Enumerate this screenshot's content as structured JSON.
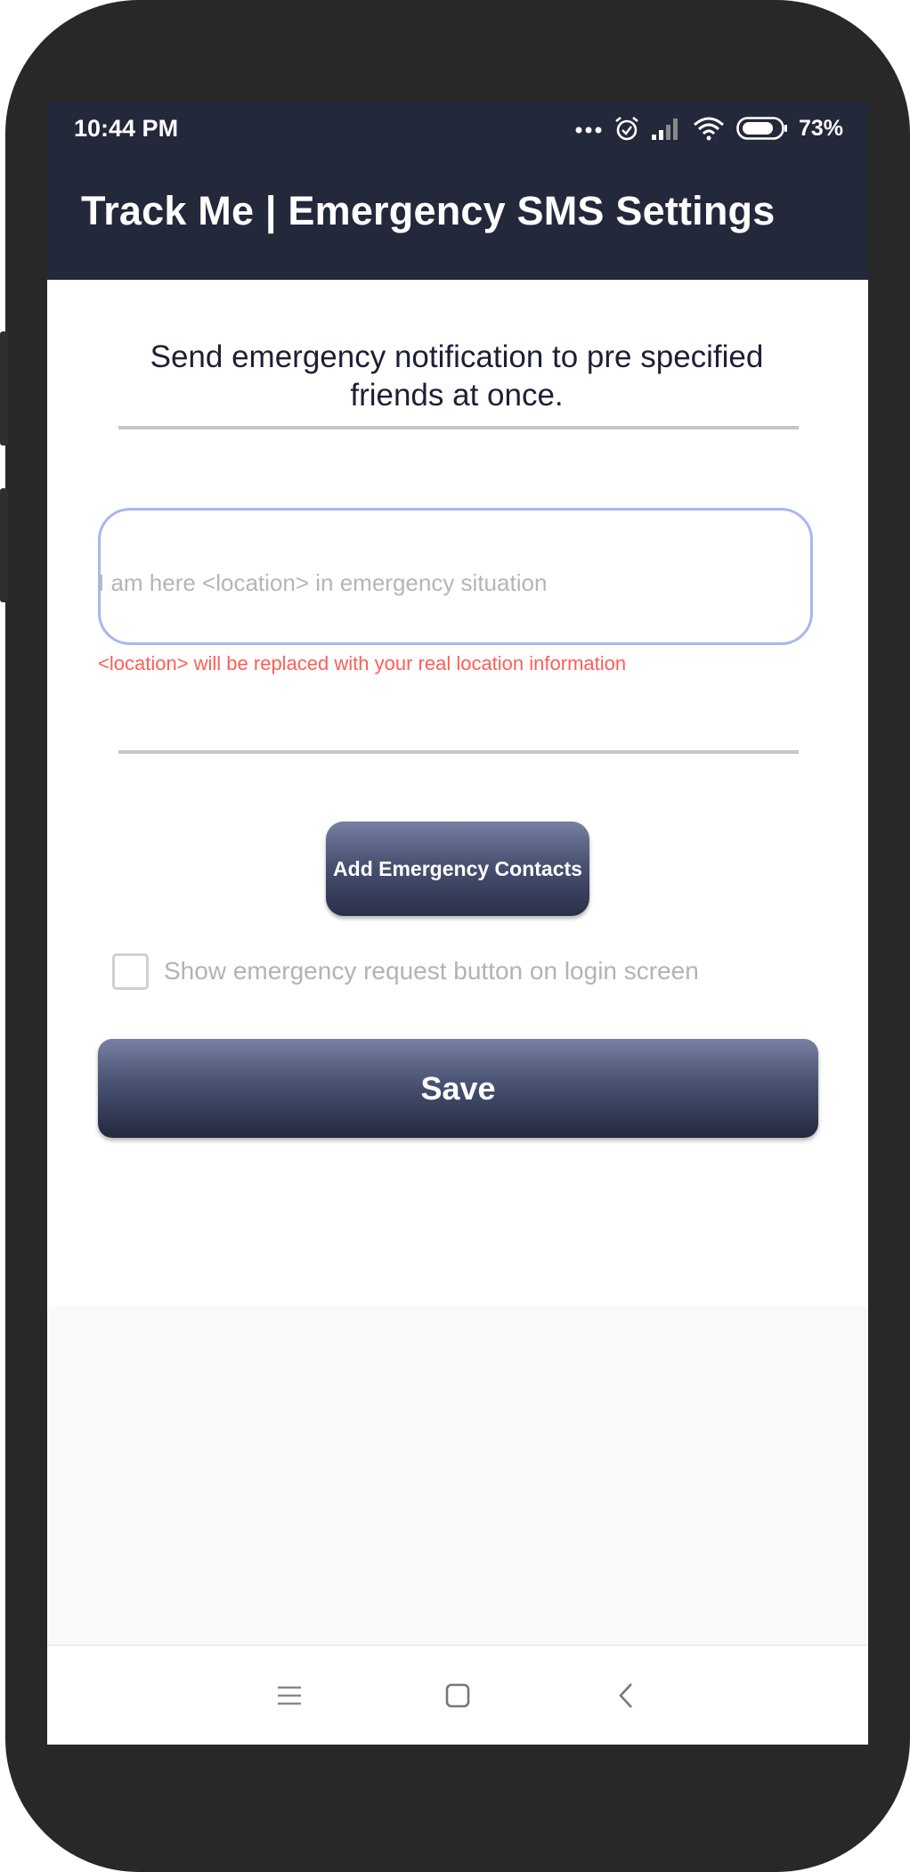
{
  "status_bar": {
    "time": "10:44 PM",
    "battery_percent": "73%",
    "icons": [
      "more-dots-icon",
      "alarm-icon",
      "signal-icon",
      "wifi-icon",
      "battery-icon"
    ]
  },
  "app_bar": {
    "title": "Track Me | Emergency SMS Settings"
  },
  "main": {
    "description": "Send emergency notification to pre specified friends at once.",
    "message_input": {
      "value": "",
      "placeholder": "I am here <location> in emergency situation"
    },
    "location_hint": "<location> will be replaced with your real location information",
    "add_contacts_label": "Add Emergency Contacts",
    "show_button_checkbox": {
      "label": "Show emergency request button on login screen",
      "checked": false
    },
    "save_label": "Save"
  },
  "nav_bar": {
    "icons": [
      "menu-icon",
      "home-icon",
      "back-icon"
    ]
  },
  "colors": {
    "app_bar": "#23283b",
    "accent_start": "#777fa3",
    "accent_end": "#23283d",
    "hint_red": "#ff5e57",
    "input_border": "#a9b7ec"
  }
}
